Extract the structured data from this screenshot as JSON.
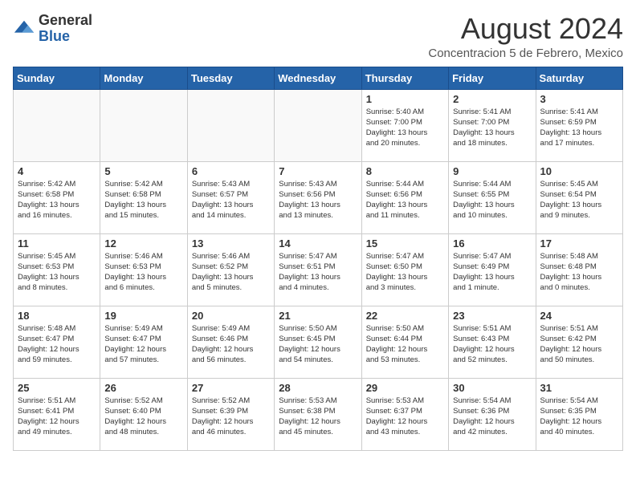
{
  "logo": {
    "general": "General",
    "blue": "Blue"
  },
  "header": {
    "month_year": "August 2024",
    "location": "Concentracion 5 de Febrero, Mexico"
  },
  "days_of_week": [
    "Sunday",
    "Monday",
    "Tuesday",
    "Wednesday",
    "Thursday",
    "Friday",
    "Saturday"
  ],
  "weeks": [
    [
      {
        "day": "",
        "info": ""
      },
      {
        "day": "",
        "info": ""
      },
      {
        "day": "",
        "info": ""
      },
      {
        "day": "",
        "info": ""
      },
      {
        "day": "1",
        "info": "Sunrise: 5:40 AM\nSunset: 7:00 PM\nDaylight: 13 hours\nand 20 minutes."
      },
      {
        "day": "2",
        "info": "Sunrise: 5:41 AM\nSunset: 7:00 PM\nDaylight: 13 hours\nand 18 minutes."
      },
      {
        "day": "3",
        "info": "Sunrise: 5:41 AM\nSunset: 6:59 PM\nDaylight: 13 hours\nand 17 minutes."
      }
    ],
    [
      {
        "day": "4",
        "info": "Sunrise: 5:42 AM\nSunset: 6:58 PM\nDaylight: 13 hours\nand 16 minutes."
      },
      {
        "day": "5",
        "info": "Sunrise: 5:42 AM\nSunset: 6:58 PM\nDaylight: 13 hours\nand 15 minutes."
      },
      {
        "day": "6",
        "info": "Sunrise: 5:43 AM\nSunset: 6:57 PM\nDaylight: 13 hours\nand 14 minutes."
      },
      {
        "day": "7",
        "info": "Sunrise: 5:43 AM\nSunset: 6:56 PM\nDaylight: 13 hours\nand 13 minutes."
      },
      {
        "day": "8",
        "info": "Sunrise: 5:44 AM\nSunset: 6:56 PM\nDaylight: 13 hours\nand 11 minutes."
      },
      {
        "day": "9",
        "info": "Sunrise: 5:44 AM\nSunset: 6:55 PM\nDaylight: 13 hours\nand 10 minutes."
      },
      {
        "day": "10",
        "info": "Sunrise: 5:45 AM\nSunset: 6:54 PM\nDaylight: 13 hours\nand 9 minutes."
      }
    ],
    [
      {
        "day": "11",
        "info": "Sunrise: 5:45 AM\nSunset: 6:53 PM\nDaylight: 13 hours\nand 8 minutes."
      },
      {
        "day": "12",
        "info": "Sunrise: 5:46 AM\nSunset: 6:53 PM\nDaylight: 13 hours\nand 6 minutes."
      },
      {
        "day": "13",
        "info": "Sunrise: 5:46 AM\nSunset: 6:52 PM\nDaylight: 13 hours\nand 5 minutes."
      },
      {
        "day": "14",
        "info": "Sunrise: 5:47 AM\nSunset: 6:51 PM\nDaylight: 13 hours\nand 4 minutes."
      },
      {
        "day": "15",
        "info": "Sunrise: 5:47 AM\nSunset: 6:50 PM\nDaylight: 13 hours\nand 3 minutes."
      },
      {
        "day": "16",
        "info": "Sunrise: 5:47 AM\nSunset: 6:49 PM\nDaylight: 13 hours\nand 1 minute."
      },
      {
        "day": "17",
        "info": "Sunrise: 5:48 AM\nSunset: 6:48 PM\nDaylight: 13 hours\nand 0 minutes."
      }
    ],
    [
      {
        "day": "18",
        "info": "Sunrise: 5:48 AM\nSunset: 6:47 PM\nDaylight: 12 hours\nand 59 minutes."
      },
      {
        "day": "19",
        "info": "Sunrise: 5:49 AM\nSunset: 6:47 PM\nDaylight: 12 hours\nand 57 minutes."
      },
      {
        "day": "20",
        "info": "Sunrise: 5:49 AM\nSunset: 6:46 PM\nDaylight: 12 hours\nand 56 minutes."
      },
      {
        "day": "21",
        "info": "Sunrise: 5:50 AM\nSunset: 6:45 PM\nDaylight: 12 hours\nand 54 minutes."
      },
      {
        "day": "22",
        "info": "Sunrise: 5:50 AM\nSunset: 6:44 PM\nDaylight: 12 hours\nand 53 minutes."
      },
      {
        "day": "23",
        "info": "Sunrise: 5:51 AM\nSunset: 6:43 PM\nDaylight: 12 hours\nand 52 minutes."
      },
      {
        "day": "24",
        "info": "Sunrise: 5:51 AM\nSunset: 6:42 PM\nDaylight: 12 hours\nand 50 minutes."
      }
    ],
    [
      {
        "day": "25",
        "info": "Sunrise: 5:51 AM\nSunset: 6:41 PM\nDaylight: 12 hours\nand 49 minutes."
      },
      {
        "day": "26",
        "info": "Sunrise: 5:52 AM\nSunset: 6:40 PM\nDaylight: 12 hours\nand 48 minutes."
      },
      {
        "day": "27",
        "info": "Sunrise: 5:52 AM\nSunset: 6:39 PM\nDaylight: 12 hours\nand 46 minutes."
      },
      {
        "day": "28",
        "info": "Sunrise: 5:53 AM\nSunset: 6:38 PM\nDaylight: 12 hours\nand 45 minutes."
      },
      {
        "day": "29",
        "info": "Sunrise: 5:53 AM\nSunset: 6:37 PM\nDaylight: 12 hours\nand 43 minutes."
      },
      {
        "day": "30",
        "info": "Sunrise: 5:54 AM\nSunset: 6:36 PM\nDaylight: 12 hours\nand 42 minutes."
      },
      {
        "day": "31",
        "info": "Sunrise: 5:54 AM\nSunset: 6:35 PM\nDaylight: 12 hours\nand 40 minutes."
      }
    ]
  ]
}
